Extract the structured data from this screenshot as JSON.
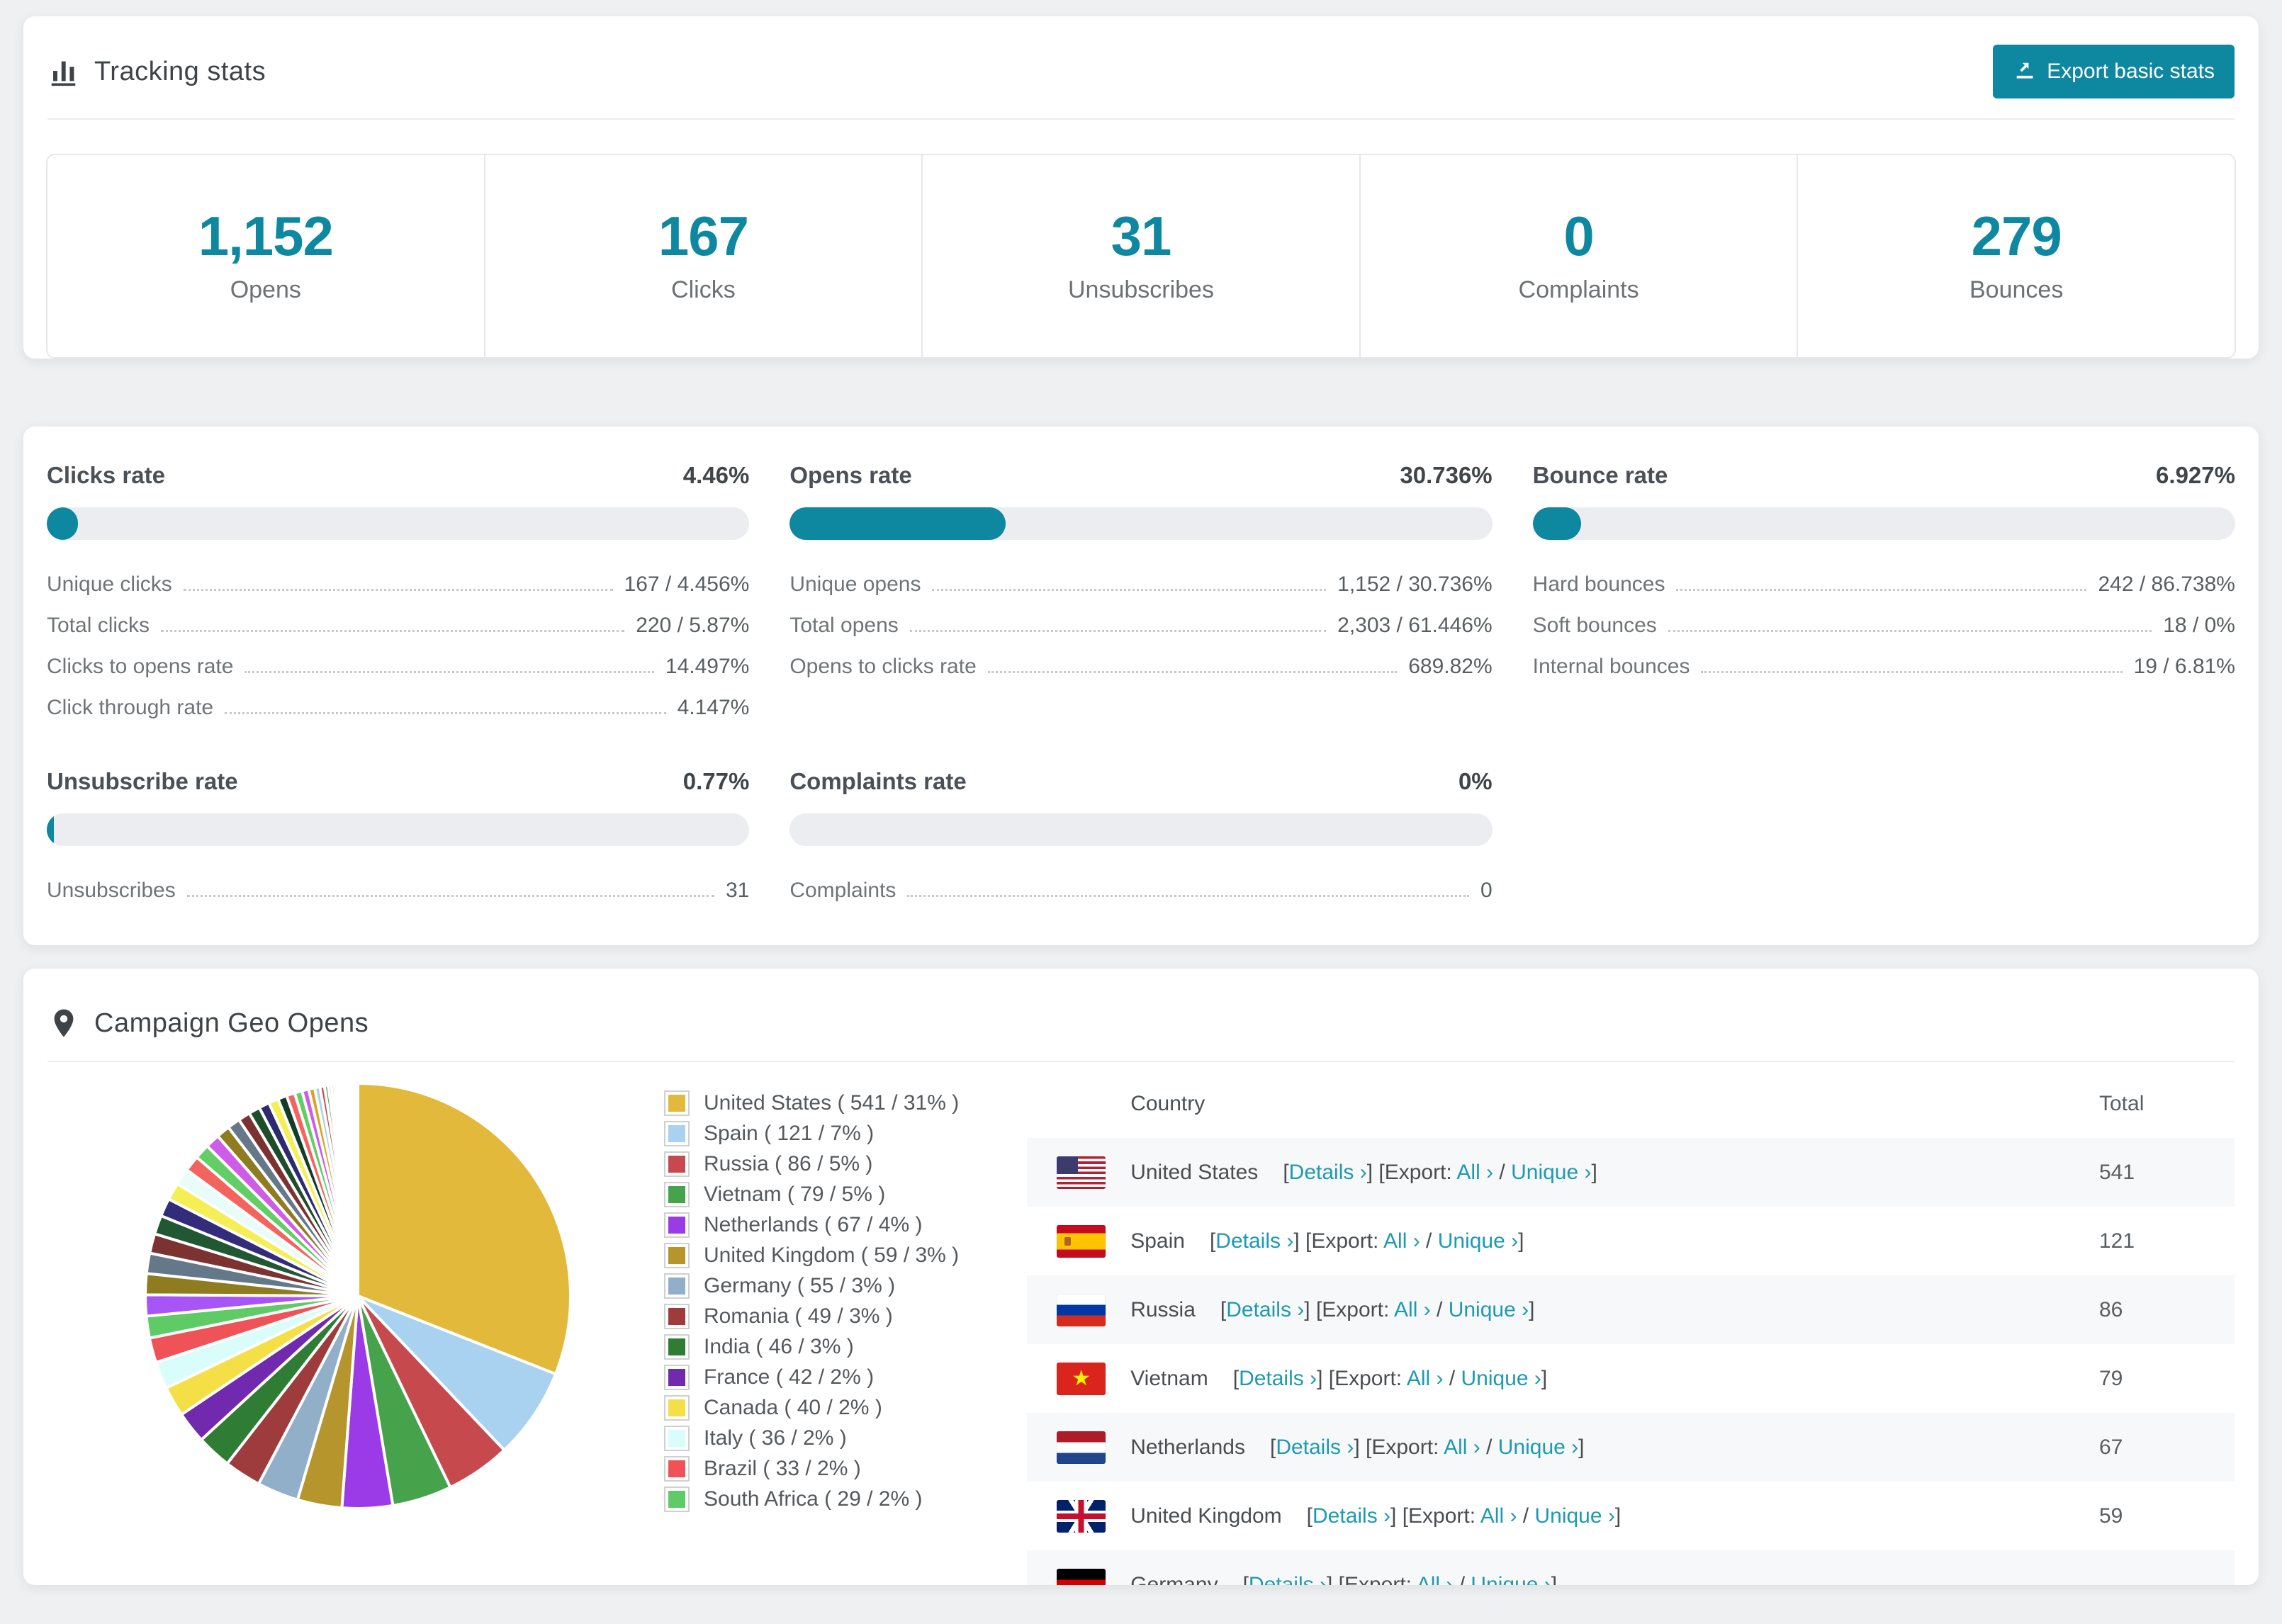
{
  "page": {
    "bg": "#eef0f1",
    "accent": "#0e87a0",
    "link_color": "#1e9ab0"
  },
  "tracking": {
    "title": "Tracking stats",
    "icon": "bar-chart-icon",
    "export_button": {
      "label": "Export basic stats",
      "icon": "export-icon"
    },
    "stats": [
      {
        "value": "1,152",
        "label": "Opens"
      },
      {
        "value": "167",
        "label": "Clicks"
      },
      {
        "value": "31",
        "label": "Unsubscribes"
      },
      {
        "value": "0",
        "label": "Complaints"
      },
      {
        "value": "279",
        "label": "Bounces"
      }
    ]
  },
  "rates": {
    "panels": [
      {
        "title": "Clicks rate",
        "value": "4.46%",
        "percent": 4.46,
        "rows": [
          {
            "label": "Unique clicks",
            "value": "167 / 4.456%"
          },
          {
            "label": "Total clicks",
            "value": "220 / 5.87%"
          },
          {
            "label": "Clicks to opens rate",
            "value": "14.497%"
          },
          {
            "label": "Click through rate",
            "value": "4.147%"
          }
        ]
      },
      {
        "title": "Opens rate",
        "value": "30.736%",
        "percent": 30.736,
        "rows": [
          {
            "label": "Unique opens",
            "value": "1,152 / 30.736%"
          },
          {
            "label": "Total opens",
            "value": "2,303 / 61.446%"
          },
          {
            "label": "Opens to clicks rate",
            "value": "689.82%"
          }
        ]
      },
      {
        "title": "Bounce rate",
        "value": "6.927%",
        "percent": 6.927,
        "rows": [
          {
            "label": "Hard bounces",
            "value": "242 / 86.738%"
          },
          {
            "label": "Soft bounces",
            "value": "18 / 0%"
          },
          {
            "label": "Internal bounces",
            "value": "19 / 6.81%"
          }
        ]
      },
      {
        "title": "Unsubscribe rate",
        "value": "0.77%",
        "percent": 0.77,
        "rows": [
          {
            "label": "Unsubscribes",
            "value": "31"
          }
        ]
      },
      {
        "title": "Complaints rate",
        "value": "0%",
        "percent": 0,
        "rows": [
          {
            "label": "Complaints",
            "value": "0"
          }
        ]
      }
    ]
  },
  "geo": {
    "title": "Campaign Geo Opens",
    "icon": "map-pin-icon",
    "table": {
      "columns": [
        "Country",
        "Total"
      ],
      "link_parts": {
        "open": "[",
        "details": "Details ›",
        "mid": "] [Export: ",
        "all": "All ›",
        "sep": " / ",
        "unique": "Unique ›",
        "close": "]"
      },
      "rows": [
        {
          "country": "United States",
          "flag": "us",
          "total": "541"
        },
        {
          "country": "Spain",
          "flag": "es",
          "total": "121"
        },
        {
          "country": "Russia",
          "flag": "ru",
          "total": "86"
        },
        {
          "country": "Vietnam",
          "flag": "vn",
          "total": "79"
        },
        {
          "country": "Netherlands",
          "flag": "nl",
          "total": "67"
        },
        {
          "country": "United Kingdom",
          "flag": "gb",
          "total": "59"
        },
        {
          "country": "Germany",
          "flag": "de",
          "total": ""
        }
      ]
    }
  },
  "chart_data": {
    "type": "pie",
    "title": "Campaign Geo Opens",
    "legend_position": "right",
    "start_angle": "top",
    "direction": "clockwise",
    "slices": [
      {
        "label": "United States",
        "value": 541,
        "pct": "31%",
        "color": "#e2b93b",
        "legend": "United States ( 541 / 31% )"
      },
      {
        "label": "Spain",
        "value": 121,
        "pct": "7%",
        "color": "#a9d1f0",
        "legend": "Spain ( 121 / 7% )"
      },
      {
        "label": "Russia",
        "value": 86,
        "pct": "5%",
        "color": "#c64a4d",
        "legend": "Russia ( 86 / 5% )"
      },
      {
        "label": "Vietnam",
        "value": 79,
        "pct": "5%",
        "color": "#47a34b",
        "legend": "Vietnam ( 79 / 5% )"
      },
      {
        "label": "Netherlands",
        "value": 67,
        "pct": "4%",
        "color": "#9b3be8",
        "legend": "Netherlands ( 67 / 4% )"
      },
      {
        "label": "United Kingdom",
        "value": 59,
        "pct": "3%",
        "color": "#b6952c",
        "legend": "United Kingdom ( 59 / 3% )"
      },
      {
        "label": "Germany",
        "value": 55,
        "pct": "3%",
        "color": "#91afc9",
        "legend": "Germany ( 55 / 3% )"
      },
      {
        "label": "Romania",
        "value": 49,
        "pct": "3%",
        "color": "#9e3b3d",
        "legend": "Romania ( 49 / 3% )"
      },
      {
        "label": "India",
        "value": 46,
        "pct": "3%",
        "color": "#2f7c34",
        "legend": "India ( 46 / 3% )"
      },
      {
        "label": "France",
        "value": 42,
        "pct": "2%",
        "color": "#7129ad",
        "legend": "France ( 42 / 2% )"
      },
      {
        "label": "Canada",
        "value": 40,
        "pct": "2%",
        "color": "#f5df47",
        "legend": "Canada ( 40 / 2% )"
      },
      {
        "label": "Italy",
        "value": 36,
        "pct": "2%",
        "color": "#d8fdfa",
        "legend": "Italy ( 36 / 2% )"
      },
      {
        "label": "Brazil",
        "value": 33,
        "pct": "2%",
        "color": "#ef5257",
        "legend": "Brazil ( 33 / 2% )"
      },
      {
        "label": "South Africa",
        "value": 29,
        "pct": "2%",
        "color": "#5ecb66",
        "legend": "South Africa ( 29 / 2% )"
      }
    ],
    "unlabeled_tail": {
      "values": [
        28,
        28,
        27,
        26,
        25,
        24,
        23,
        22,
        21,
        20,
        19,
        18,
        17,
        16,
        15,
        14,
        13,
        12,
        11,
        10,
        9,
        8,
        7,
        6,
        5,
        4,
        4,
        3,
        3,
        2,
        2,
        2,
        2,
        2,
        1,
        1,
        1,
        1,
        1,
        1,
        1,
        1,
        1,
        1,
        1,
        1,
        1,
        1,
        1
      ],
      "colors": [
        "#a855f7",
        "#8f7c21",
        "#64788a",
        "#7c3230",
        "#215732",
        "#332c7a",
        "#f3ef55",
        "#e8fcfa",
        "#f4645f",
        "#62ce66",
        "#cf5ce8",
        "#8f7c21",
        "#64788a",
        "#7c3230",
        "#1e4d2b",
        "#2e2a72",
        "#f3ef55",
        "#123d28",
        "#f4645f",
        "#62ce66",
        "#cf5ce8",
        "#d9a520",
        "#a9d1f0",
        "#c64a4d",
        "#47a34b",
        "#9b3be8",
        "#b6952c",
        "#91afc9",
        "#9e3b3d",
        "#2f7c34",
        "#7129ad",
        "#f5df47",
        "#d8fdfa",
        "#ef5257",
        "#5ecb66",
        "#a855f7",
        "#8f7c21",
        "#64788a",
        "#7c3230",
        "#215732",
        "#332c7a",
        "#f3ef55",
        "#e8fcfa",
        "#f4645f",
        "#62ce66",
        "#cf5ce8",
        "#d9a520",
        "#a9d1f0",
        "#c64a4d"
      ]
    }
  }
}
